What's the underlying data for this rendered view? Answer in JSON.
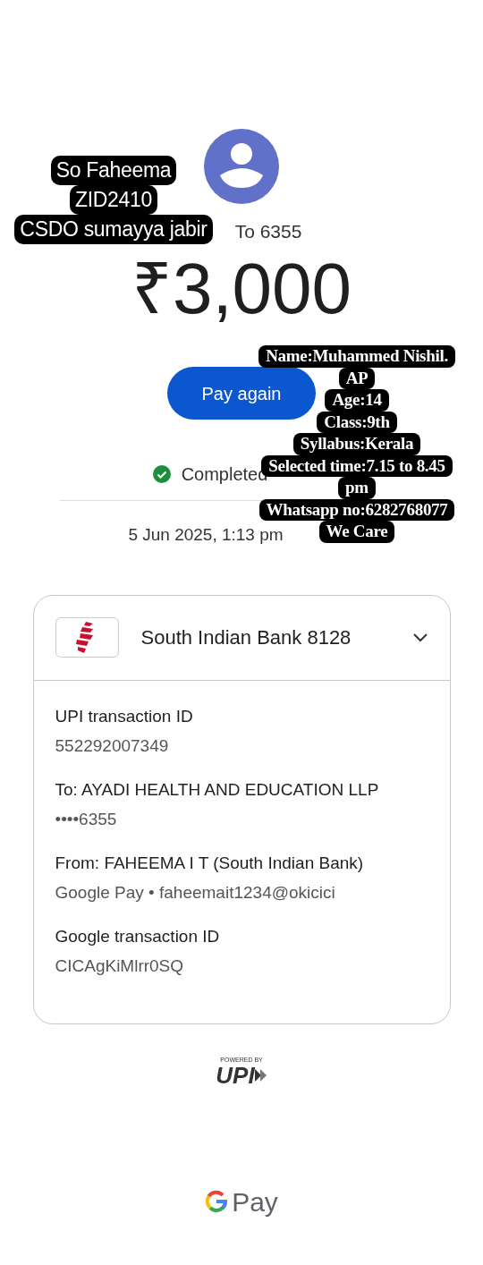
{
  "overlay_left": [
    "So Faheema",
    "ZID2410",
    "CSDO sumayya jabir"
  ],
  "recipient": {
    "label": "To 6355"
  },
  "amount": "₹3,000",
  "button": "Pay again",
  "status": {
    "kind": "completed",
    "text": "Completed"
  },
  "date": "5 Jun 2025, 1:13 pm",
  "overlay_right": [
    "Name:Muhammed Nishil.",
    "AP",
    "Age:14",
    "Class:9th",
    "Syllabus:Kerala",
    "Selected time:7.15 to 8.45",
    "pm",
    "Whatsapp no:6282768077",
    "We Care"
  ],
  "account": {
    "bank": "South Indian Bank 8128",
    "expanded": false
  },
  "details": [
    {
      "label": "UPI transaction ID",
      "value": "552292007349"
    },
    {
      "label": "To: AYADI HEALTH AND EDUCATION LLP",
      "value": "••••6355"
    },
    {
      "label": "From: FAHEEMA I T (South Indian Bank)",
      "value": "Google Pay • faheemait1234@okicici"
    },
    {
      "label": "Google transaction ID",
      "value": "CICAgKiMlrr0SQ"
    }
  ],
  "footer": {
    "powered_by": "POWERED BY",
    "upi": "UPI",
    "brand": "Pay"
  }
}
